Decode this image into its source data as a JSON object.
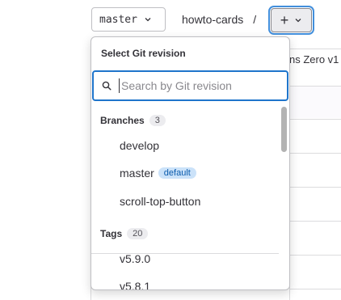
{
  "header": {
    "branch_selector": "master",
    "breadcrumb_project": "howto-cards",
    "breadcrumb_separator": "/",
    "add_button": "+"
  },
  "background": {
    "column_header_text": "ns Zero v1"
  },
  "dropdown": {
    "title": "Select Git revision",
    "search_placeholder": "Search by Git revision",
    "search_value": "",
    "branches_label": "Branches",
    "branches_count": "3",
    "branches": [
      {
        "name": "develop"
      },
      {
        "name": "master",
        "badge": "default"
      },
      {
        "name": "scroll-top-button"
      }
    ],
    "tags_label": "Tags",
    "tags_count": "20",
    "tags": [
      {
        "name": "v5.9.0"
      },
      {
        "name": "v5.8.1"
      }
    ]
  },
  "colors": {
    "focus_ring": "#1f75cb",
    "default_badge_bg": "#cbe2f9",
    "default_badge_text": "#0b5cad"
  }
}
